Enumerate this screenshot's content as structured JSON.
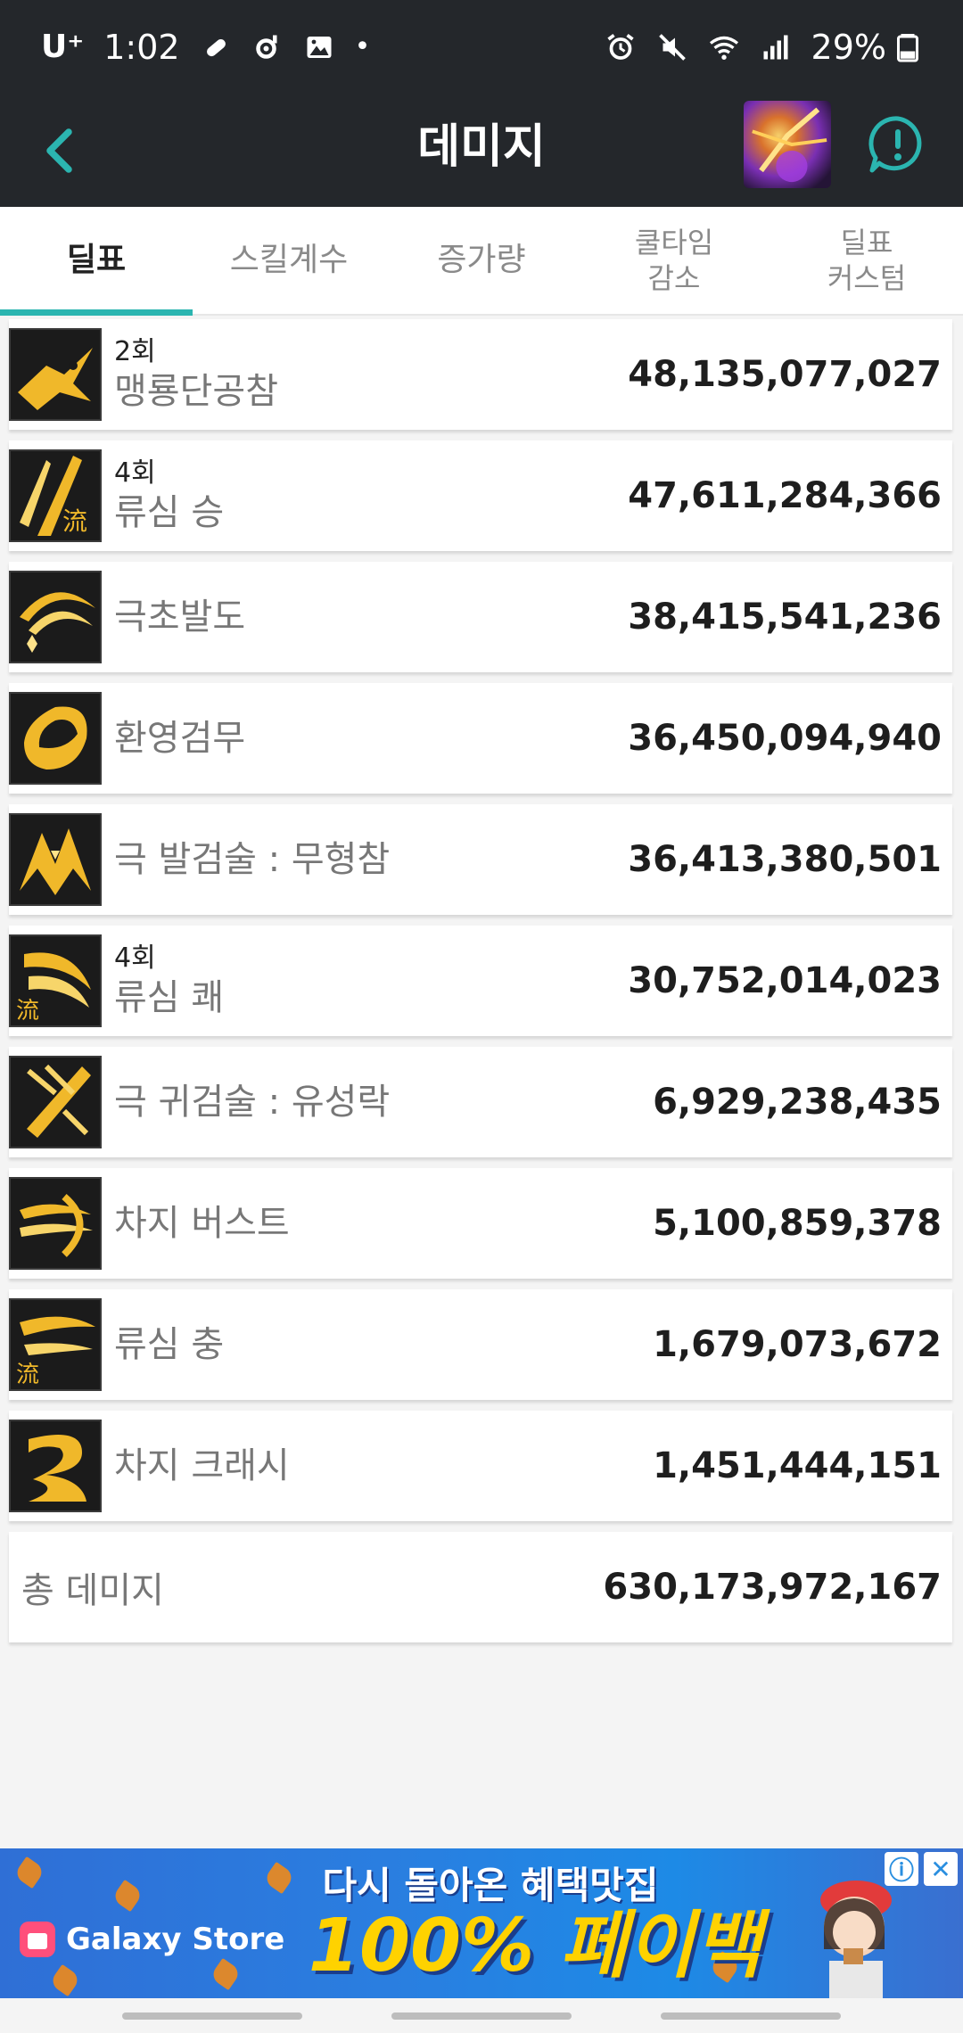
{
  "status_bar": {
    "carrier": "U⁺",
    "time": "1:02",
    "dot": "•",
    "battery": "29%",
    "icons": [
      "pill-icon",
      "music-icon",
      "gallery-icon",
      "alarm-icon",
      "mute-icon",
      "wifi-icon",
      "signal-icon",
      "battery-icon"
    ]
  },
  "app_bar": {
    "title": "데미지",
    "back_icon": "chevron-left-icon",
    "alert_icon": "alert-chat-icon"
  },
  "tabs": [
    {
      "label": "딜표",
      "active": true
    },
    {
      "label": "스킬계수",
      "active": false
    },
    {
      "label": "증가량",
      "active": false
    },
    {
      "label": "쿨타임\n감소",
      "active": false
    },
    {
      "label": "딜표\n커스텀",
      "active": false
    }
  ],
  "skills": [
    {
      "count": "2회",
      "name": "맹룡단공참",
      "damage": "48,135,077,027",
      "icon": "dragon-skill-icon"
    },
    {
      "count": "4회",
      "name": "류심 승",
      "damage": "47,611,284,366",
      "icon": "ryu-slash-skill-icon"
    },
    {
      "count": "",
      "name": "극초발도",
      "damage": "38,415,541,236",
      "icon": "crescent-slash-skill-icon"
    },
    {
      "count": "",
      "name": "환영검무",
      "damage": "36,450,094,940",
      "icon": "phantom-dance-skill-icon"
    },
    {
      "count": "",
      "name": "극 발검술 : 무형참",
      "damage": "36,413,380,501",
      "icon": "burst-slash-skill-icon"
    },
    {
      "count": "4회",
      "name": "류심 쾌",
      "damage": "30,752,014,023",
      "icon": "ryu-swift-skill-icon"
    },
    {
      "count": "",
      "name": "극 귀검술 : 유성락",
      "damage": "6,929,238,435",
      "icon": "meteor-skill-icon"
    },
    {
      "count": "",
      "name": "차지 버스트",
      "damage": "5,100,859,378",
      "icon": "charge-burst-skill-icon"
    },
    {
      "count": "",
      "name": "류심 충",
      "damage": "1,679,073,672",
      "icon": "ryu-thrust-skill-icon"
    },
    {
      "count": "",
      "name": "차지 크래시",
      "damage": "1,451,444,151",
      "icon": "charge-crash-skill-icon"
    }
  ],
  "total": {
    "label": "총 데미지",
    "damage": "630,173,972,167"
  },
  "ad": {
    "store": "Galaxy Store",
    "headline": "다시 돌아온 혜택맛집",
    "big_text": "100% 페이백",
    "info": "ⓘ",
    "close": "✕"
  },
  "colors": {
    "accent": "#2bb5b0",
    "header_bg": "#24272b",
    "icon_gold": "#f0b82a"
  }
}
